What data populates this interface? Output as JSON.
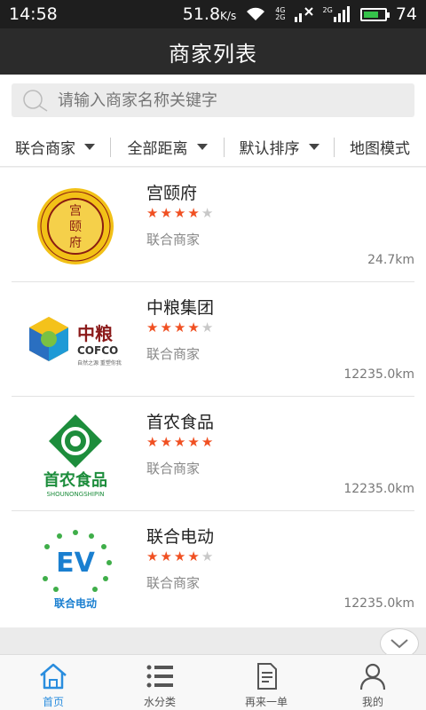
{
  "status_bar": {
    "time": "14:58",
    "speed": "51.8",
    "speed_unit": "K/s",
    "battery": "74",
    "battery_level": 0.74,
    "net_1": "4G",
    "net_2": "2G"
  },
  "header": {
    "title": "商家列表"
  },
  "search": {
    "placeholder": "请输入商家名称关键字"
  },
  "filters": [
    {
      "label": "联合商家"
    },
    {
      "label": "全部距离"
    },
    {
      "label": "默认排序"
    },
    {
      "label": "地图模式"
    }
  ],
  "merchants": [
    {
      "name": "宫颐府",
      "rating": 4,
      "type": "联合商家",
      "distance": "24.7km",
      "logo": "gongyifu-seal-logo"
    },
    {
      "name": "中粮集团",
      "rating": 4,
      "type": "联合商家",
      "distance": "12235.0km",
      "logo": "cofco-logo",
      "logo_text": "中粮",
      "logo_sub": "COFCO",
      "logo_slogan": "自然之源 重塑你我"
    },
    {
      "name": "首农食品",
      "rating": 5,
      "type": "联合商家",
      "distance": "12235.0km",
      "logo": "shounong-logo",
      "logo_text": "首农食品",
      "logo_sub": "SHOUNONGSHIPIN"
    },
    {
      "name": "联合电动",
      "rating": 4,
      "type": "联合商家",
      "distance": "12235.0km",
      "logo": "ev-logo",
      "logo_text": "EV",
      "logo_sub": "联合电动"
    }
  ],
  "tabbar": [
    {
      "label": "首页",
      "icon": "home-icon",
      "active": true
    },
    {
      "label": "水分类",
      "icon": "list-icon"
    },
    {
      "label": "再来一单",
      "icon": "document-icon"
    },
    {
      "label": "我的",
      "icon": "user-icon"
    }
  ],
  "colors": {
    "accent": "#2a8dde",
    "star": "#f05022",
    "header": "#2b2b2b"
  }
}
